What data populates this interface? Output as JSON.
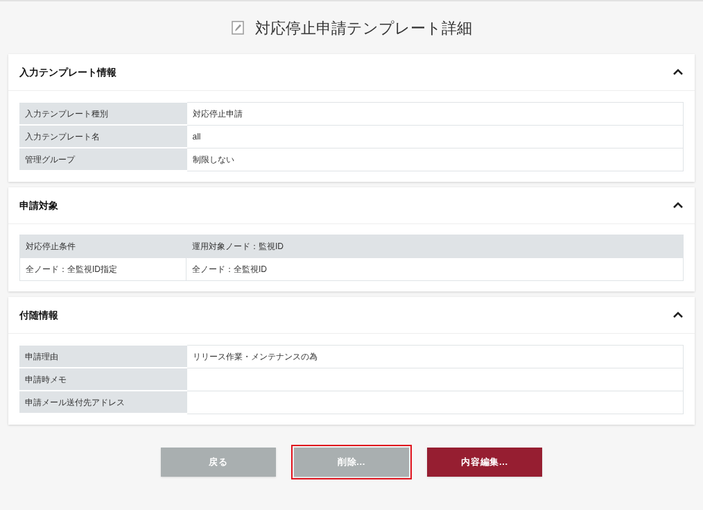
{
  "title": "対応停止申請テンプレート詳細",
  "sections": [
    {
      "heading": "入力テンプレート情報",
      "expanded": true,
      "table": {
        "kind": "key_value",
        "rows": [
          {
            "label": "入力テンプレート種別",
            "value": "対応停止申請"
          },
          {
            "label": "入力テンプレート名",
            "value": "all"
          },
          {
            "label": "管理グループ",
            "value": "制限しない"
          }
        ]
      }
    },
    {
      "heading": "申請対象",
      "expanded": true,
      "table": {
        "kind": "grid",
        "header": [
          "対応停止条件",
          "運用対象ノード：監視ID"
        ],
        "rows": [
          [
            "全ノード：全監視ID指定",
            "全ノード：全監視ID"
          ]
        ]
      }
    },
    {
      "heading": "付随情報",
      "expanded": true,
      "table": {
        "kind": "key_value",
        "rows": [
          {
            "label": "申請理由",
            "value": "リリース作業・メンテナンスの為"
          },
          {
            "label": "申請時メモ"
          },
          {
            "label": "申請メール送付先アドレス"
          }
        ]
      }
    }
  ],
  "buttons": [
    {
      "label": "戻る",
      "kind": "secondary",
      "highlighted": false
    },
    {
      "label": "削除...",
      "kind": "secondary",
      "highlighted": true
    },
    {
      "label": "内容編集...",
      "kind": "primary",
      "highlighted": false
    }
  ]
}
